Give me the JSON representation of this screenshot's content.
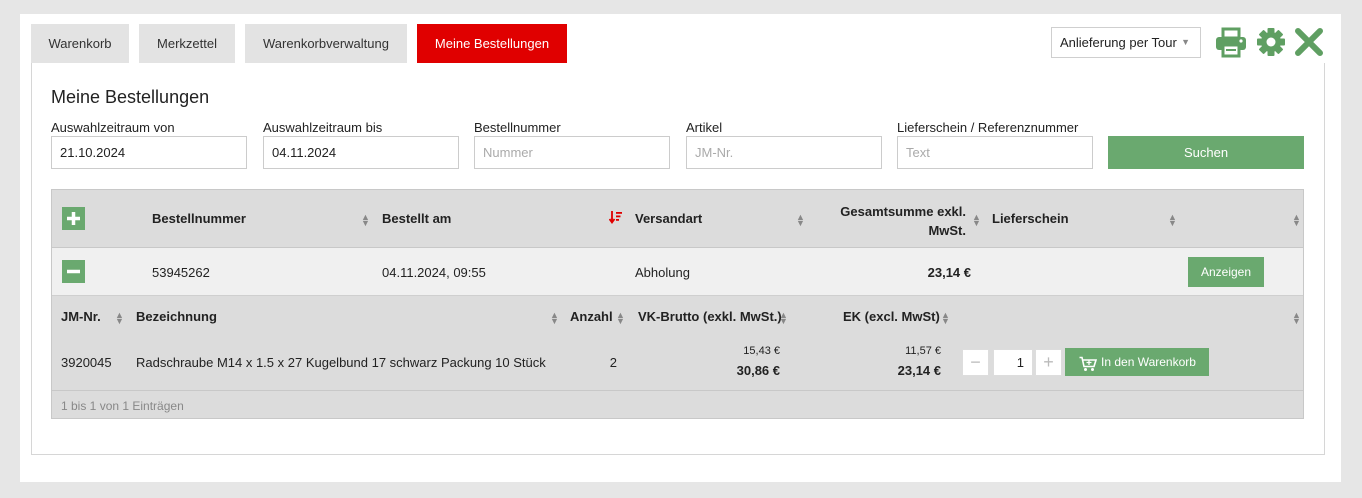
{
  "tabs": [
    {
      "label": "Warenkorb"
    },
    {
      "label": "Merkzettel"
    },
    {
      "label": "Warenkorbverwaltung"
    },
    {
      "label": "Meine Bestellungen",
      "active": true
    }
  ],
  "toolbar": {
    "delivery_select": "Anlieferung per Tour",
    "icons": [
      "printer-icon",
      "gear-icon",
      "close-icon"
    ],
    "accent_color": "#5f9f62"
  },
  "page": {
    "title": "Meine Bestellungen"
  },
  "filters": {
    "from": {
      "label": "Auswahlzeitraum von",
      "value": "21.10.2024"
    },
    "to": {
      "label": "Auswahlzeitraum bis",
      "value": "04.11.2024"
    },
    "order_no": {
      "label": "Bestellnummer",
      "placeholder": "Nummer"
    },
    "article": {
      "label": "Artikel",
      "placeholder": "JM-Nr."
    },
    "reference": {
      "label": "Lieferschein / Referenznummer",
      "placeholder": "Text"
    },
    "search_label": "Suchen"
  },
  "orders_table": {
    "columns": {
      "order_no": "Bestellnummer",
      "ordered_at": "Bestellt am",
      "shipping": "Versandart",
      "total_line1": "Gesamtsumme exkl.",
      "total_line2": "MwSt.",
      "delivery_note": "Lieferschein"
    },
    "rows": [
      {
        "order_no": "53945262",
        "ordered_at": "04.11.2024, 09:55",
        "shipping": "Abholung",
        "total": "23,14 €",
        "action_label": "Anzeigen"
      }
    ]
  },
  "detail_table": {
    "columns": {
      "jm_nr": "JM-Nr.",
      "name": "Bezeichnung",
      "qty": "Anzahl",
      "vk": "VK-Brutto (exkl. MwSt.)",
      "ek": "EK (excl. MwSt)"
    },
    "items": [
      {
        "jm_nr": "3920045",
        "name": "Radschraube M14 x 1.5 x 27 Kugelbund 17 schwarz Packung 10 Stück",
        "qty": "2",
        "vk_unit": "15,43 €",
        "vk_total": "30,86 €",
        "ek_unit": "11,57 €",
        "ek_total": "23,14 €",
        "stepper_value": "1",
        "cart_label": "In den Warenkorb"
      }
    ]
  },
  "pagination_info": "1 bis 1 von 1 Einträgen"
}
